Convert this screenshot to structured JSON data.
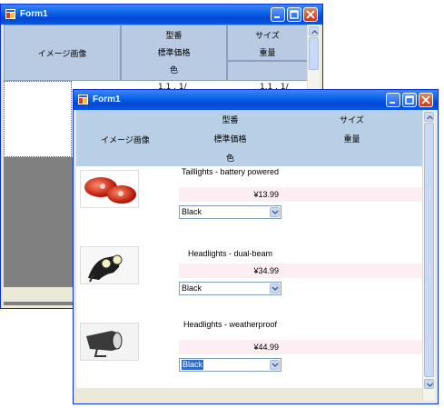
{
  "back_window": {
    "title": "Form1",
    "header": {
      "image_col": "イメージ画像",
      "model": "型番",
      "price": "標準価格",
      "color": "色",
      "size": "サイズ",
      "weight": "重量"
    },
    "partial_row_texts": [
      "1.1 . 1/",
      "1.1 . 1/"
    ]
  },
  "front_window": {
    "title": "Form1",
    "header": {
      "image_col": "イメージ画像",
      "model": "型番",
      "price": "標準価格",
      "color": "色",
      "size": "サイズ",
      "weight": "重量"
    },
    "records": [
      {
        "icon": "taillight-image",
        "name": "Taillights - battery powered",
        "price": "¥13.99",
        "color": "Black",
        "selected": false
      },
      {
        "icon": "headlight-dual-beam-image",
        "name": "Headlights - dual-beam",
        "price": "¥34.99",
        "color": "Black",
        "selected": false
      },
      {
        "icon": "headlight-weatherproof-image",
        "name": "Headlights - weatherproof",
        "price": "¥44.99",
        "color": "Black",
        "selected": true
      }
    ]
  },
  "colors": {
    "titlebar": "#0a5fe8",
    "header_bg": "#b8cfe6",
    "field_bg": "#fceef2",
    "selection": "#316ac5"
  }
}
